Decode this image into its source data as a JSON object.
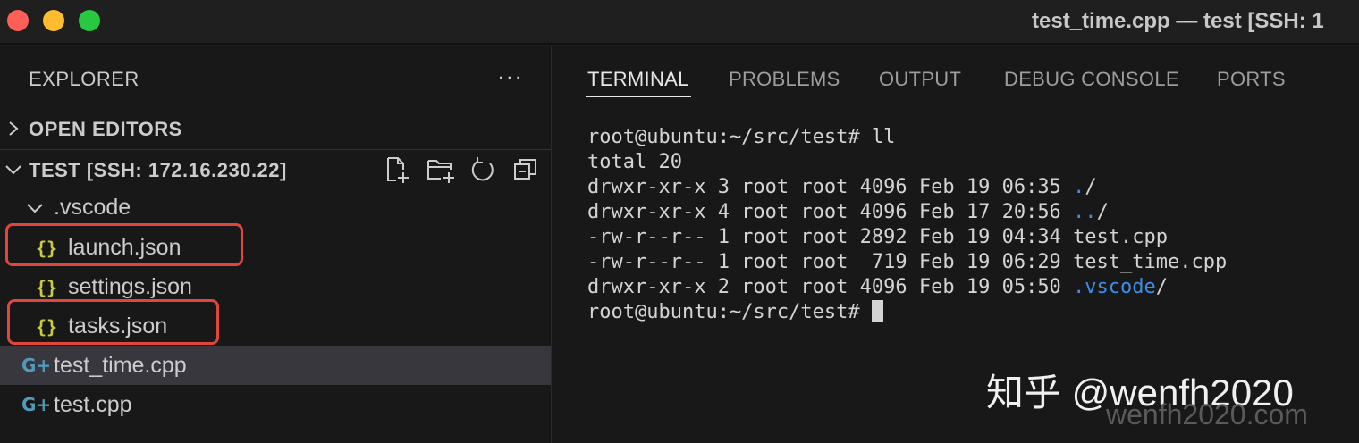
{
  "window": {
    "title": "test_time.cpp — test [SSH: 1",
    "controls": [
      "close",
      "minimize",
      "maximize"
    ]
  },
  "sidebar": {
    "title": "EXPLORER",
    "more_label": "···",
    "open_editors_label": "OPEN EDITORS",
    "workspace_label": "TEST [SSH: 172.16.230.22]",
    "workspace_actions": [
      "new-file-icon",
      "new-folder-icon",
      "refresh-icon",
      "collapse-all-icon"
    ],
    "folder": {
      "name": ".vscode",
      "expanded": true
    },
    "folder_files": [
      {
        "name": "launch.json",
        "icon": "json-icon",
        "glyph": "{}",
        "highlighted": true
      },
      {
        "name": "settings.json",
        "icon": "json-icon",
        "glyph": "{}",
        "highlighted": false
      },
      {
        "name": "tasks.json",
        "icon": "json-icon",
        "glyph": "{}",
        "highlighted": true
      }
    ],
    "root_files": [
      {
        "name": "test_time.cpp",
        "icon": "cpp-icon",
        "glyph": "G+",
        "selected": true
      },
      {
        "name": "test.cpp",
        "icon": "cpp-icon",
        "glyph": "G+",
        "selected": false
      }
    ]
  },
  "panel": {
    "tabs": [
      "TERMINAL",
      "PROBLEMS",
      "OUTPUT",
      "DEBUG CONSOLE",
      "PORTS"
    ],
    "active_tab": "TERMINAL",
    "terminal": {
      "prompt": "root@ubuntu:~/src/test# ",
      "command": "ll",
      "total": "total 20",
      "entries": [
        {
          "prefix": "drwxr-xr-x 3 root root 4096 Feb 19 06:35 ",
          "name": ".",
          "suffix": "/",
          "is_dir": true
        },
        {
          "prefix": "drwxr-xr-x 4 root root 4096 Feb 17 20:56 ",
          "name": "..",
          "suffix": "/",
          "is_dir": true
        },
        {
          "prefix": "-rw-r--r-- 1 root root 2892 Feb 19 04:34 ",
          "name": "test.cpp",
          "suffix": "",
          "is_dir": false
        },
        {
          "prefix": "-rw-r--r-- 1 root root  719 Feb 19 06:29 ",
          "name": "test_time.cpp",
          "suffix": "",
          "is_dir": false
        },
        {
          "prefix": "drwxr-xr-x 2 root root 4096 Feb 19 05:50 ",
          "name": ".vscode",
          "suffix": "/",
          "is_dir": true
        }
      ],
      "final_prompt": "root@ubuntu:~/src/test# "
    }
  },
  "watermark": {
    "primary": "知乎 @wenfh2020",
    "secondary": "wenfh2020.com"
  },
  "colors": {
    "background": "#181818",
    "highlight_box": "#e2463a",
    "json_icon": "#cbcb41",
    "cpp_icon": "#519aba",
    "dir_link": "#3b8eea"
  }
}
